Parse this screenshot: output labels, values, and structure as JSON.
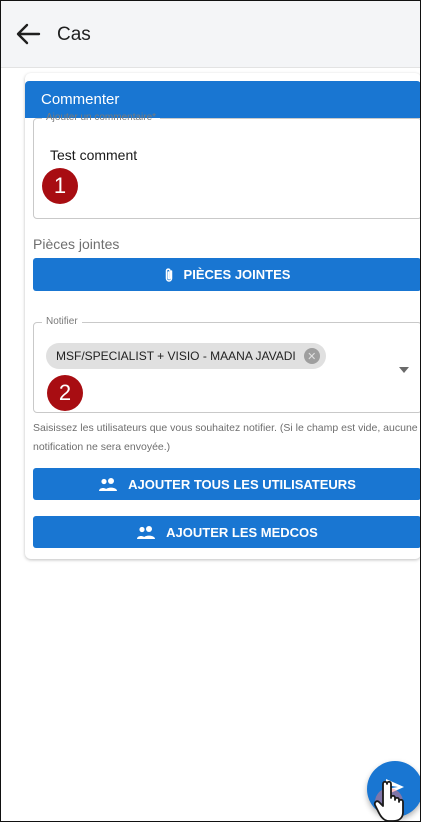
{
  "header": {
    "title": "Cas",
    "back_icon": "arrow-left-icon"
  },
  "card": {
    "title": "Commenter",
    "comment": {
      "label": "Ajouter un commentaire*",
      "value": "Test comment"
    },
    "attachments": {
      "section_label": "Pièces jointes",
      "button_label": "PIÈCES JOINTES",
      "icon": "paperclip-icon"
    },
    "notify": {
      "label": "Notifier",
      "selected_chip": "MSF/SPECIALIST + VISIO - MAANA JAVADI",
      "helper_text": "Saisissez les utilisateurs que vous souhaitez notifier. (Si le champ est vide, aucune notification ne sera envoyée.)"
    },
    "add_all_button": "AJOUTER TOUS LES UTILISATEURS",
    "add_medcos_button": "AJOUTER LES MEDCOS"
  },
  "annotations": {
    "badge_1": "1",
    "badge_2": "2"
  },
  "fab": {
    "icon": "send-icon"
  },
  "colors": {
    "primary": "#1976d2",
    "badge": "#a80d12",
    "topbar": "#f4f5f7"
  }
}
